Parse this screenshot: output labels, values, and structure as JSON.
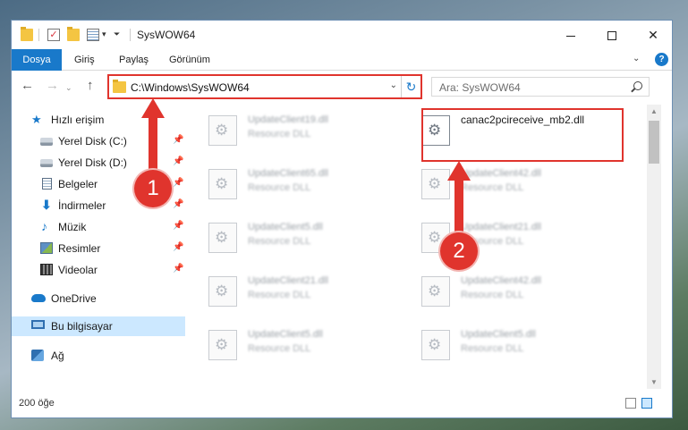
{
  "window": {
    "title": "SysWOW64"
  },
  "ribbon": {
    "tabs": [
      "Dosya",
      "Giriş",
      "Paylaş",
      "Görünüm"
    ],
    "collapse_icon": "chevron-down-icon",
    "help_label": "?"
  },
  "address": {
    "path": "C:\\Windows\\SysWOW64",
    "search_placeholder": "Ara: SysWOW64"
  },
  "sidebar": {
    "quick_access": "Hızlı erişim",
    "items": [
      {
        "label": "Yerel Disk (C:)",
        "icon": "drive-icon",
        "pinned": true
      },
      {
        "label": "Yerel Disk (D:)",
        "icon": "drive-icon",
        "pinned": true
      },
      {
        "label": "Belgeler",
        "icon": "documents-icon",
        "pinned": true
      },
      {
        "label": "İndirmeler",
        "icon": "downloads-icon",
        "pinned": true
      },
      {
        "label": "Müzik",
        "icon": "music-icon",
        "pinned": true
      },
      {
        "label": "Resimler",
        "icon": "pictures-icon",
        "pinned": true
      },
      {
        "label": "Videolar",
        "icon": "videos-icon",
        "pinned": true
      }
    ],
    "onedrive": "OneDrive",
    "this_pc": "Bu bilgisayar",
    "network": "Ağ"
  },
  "files": [
    {
      "name": "UpdateClient19.dll",
      "type": "Resource DLL"
    },
    {
      "name": "canac2pcireceive_mb2.dll",
      "type": ""
    },
    {
      "name": "UpdateClient65.dll",
      "type": "Resource DLL"
    },
    {
      "name": "UpdateClient42.dll",
      "type": "Resource DLL"
    },
    {
      "name": "UpdateClient5.dll",
      "type": "Resource DLL"
    },
    {
      "name": "UpdateClient21.dll",
      "type": "Resource DLL"
    },
    {
      "name": "UpdateClient21.dll",
      "type": "Resource DLL"
    },
    {
      "name": "UpdateClient42.dll",
      "type": "Resource DLL"
    },
    {
      "name": "UpdateClient5.dll",
      "type": "Resource DLL"
    },
    {
      "name": "UpdateClient5.dll",
      "type": "Resource DLL"
    }
  ],
  "status": {
    "item_count": "200 öğe"
  },
  "annotations": {
    "step1": "1",
    "step2": "2",
    "color": "#e0342d"
  },
  "colors": {
    "accent": "#1979ca",
    "selection": "#cce8ff"
  }
}
